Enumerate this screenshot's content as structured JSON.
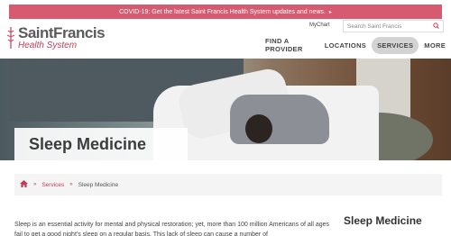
{
  "alert": {
    "text": "COVID-19: Get the latest Saint Francis Health System updates and news.",
    "caret": "▸"
  },
  "logo": {
    "brand": "SaintFrancis",
    "sub": "Health System"
  },
  "header": {
    "mychart": "MyChart",
    "search_placeholder": "Search Saint Francis"
  },
  "nav": {
    "items": [
      "FIND A PROVIDER",
      "LOCATIONS",
      "SERVICES",
      "MORE"
    ],
    "active": "SERVICES"
  },
  "hero": {
    "title": "Sleep Medicine"
  },
  "breadcrumb": {
    "items": [
      "Services",
      "Sleep Medicine"
    ],
    "sep": "»"
  },
  "content": {
    "intro": "Sleep is an essential activity for mental and physical restoration; yet, more than 100 million Americans of all ages fail to get a good night's sleep on a regular basis. This lack of sleep can cause a number of",
    "side_title": "Sleep Medicine"
  },
  "colors": {
    "brand": "#c53b55",
    "alert_bg": "#d65a70"
  }
}
